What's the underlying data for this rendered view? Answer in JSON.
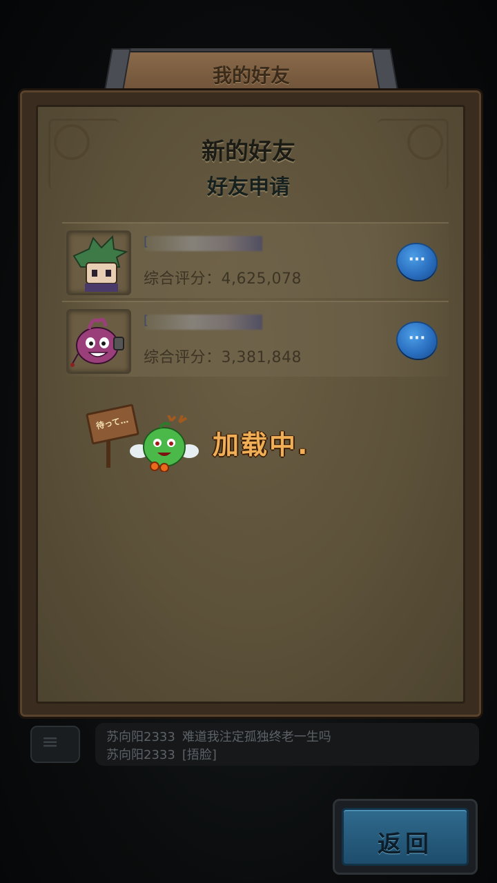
{
  "header": {
    "title": "我的好友"
  },
  "section": {
    "heading": "新的好友",
    "subheading": "好友申请"
  },
  "friend_requests": [
    {
      "name_prefix": "[",
      "score_label": "综合评分：",
      "score_value": "4,625,078"
    },
    {
      "name_prefix": "[",
      "score_label": "综合评分：",
      "score_value": "3,381,848"
    }
  ],
  "loading": {
    "text": "加载中.",
    "sign_text": "待って…"
  },
  "chat": {
    "messages": [
      {
        "user": "苏向阳2333",
        "text": "难道我注定孤独终老一生吗"
      },
      {
        "user": "苏向阳2333",
        "text": "[捂脸]"
      }
    ]
  },
  "back_button": {
    "label": "返回"
  },
  "colors": {
    "accent_blue": "#2a6fc0",
    "loading_orange": "#f0ae57",
    "panel": "#5c5139"
  }
}
